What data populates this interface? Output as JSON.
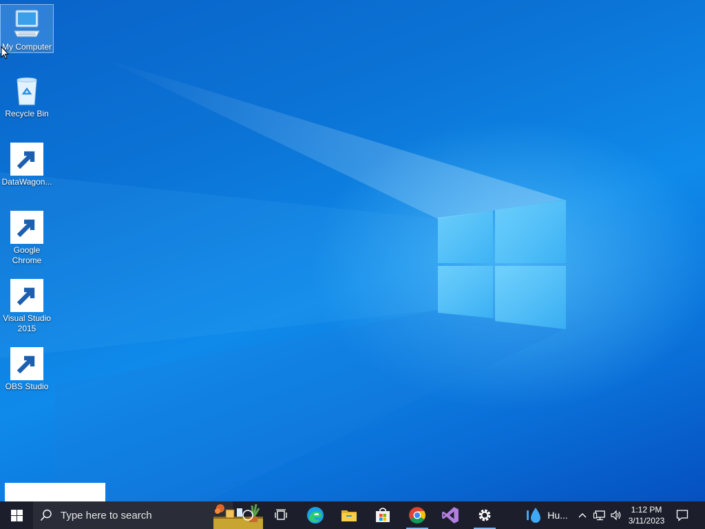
{
  "desktop_icons": [
    {
      "label": "My Computer",
      "icon": "monitor-icon",
      "selected": true
    },
    {
      "label": "Recycle Bin",
      "icon": "recycle-bin-icon"
    },
    {
      "label": "DataWagon...",
      "icon": "file-shortcut-icon"
    },
    {
      "label": "Google Chrome",
      "icon": "chrome-icon"
    },
    {
      "label": "Visual Studio 2015",
      "icon": "visual-studio-icon"
    },
    {
      "label": "OBS Studio",
      "icon": "obs-icon"
    }
  ],
  "taskbar": {
    "search_placeholder": "Type here to search",
    "pinned": [
      "cortana-icon",
      "task-view-icon",
      "edge-icon",
      "file-explorer-icon",
      "microsoft-store-icon",
      "chrome-icon",
      "visual-studio-icon",
      "settings-icon"
    ],
    "weather_text": "Hu...",
    "clock_time": "1:12 PM",
    "clock_date": "3/11/2023"
  }
}
